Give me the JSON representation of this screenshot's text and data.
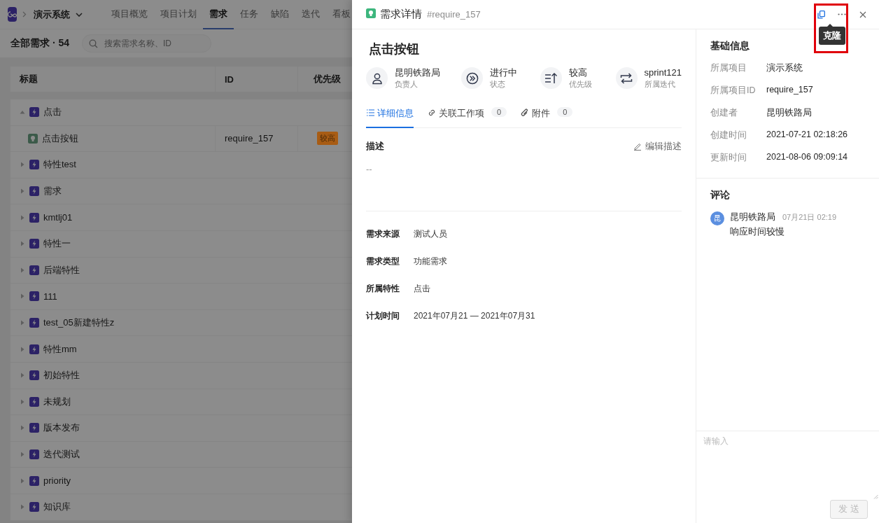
{
  "app": {
    "project": "演示系统",
    "nav_tabs": [
      {
        "label": "项目概览",
        "selected": false
      },
      {
        "label": "项目计划",
        "selected": false
      },
      {
        "label": "需求",
        "selected": true
      },
      {
        "label": "任务",
        "selected": false
      },
      {
        "label": "缺陷",
        "selected": false
      },
      {
        "label": "迭代",
        "selected": false
      },
      {
        "label": "看板",
        "selected": false
      }
    ],
    "list_title": "全部需求 · 54",
    "search": {
      "placeholder": "搜索需求名称、ID"
    },
    "table": {
      "columns": [
        "标题",
        "ID",
        "优先级"
      ],
      "rows": [
        {
          "kind": "feature",
          "title": "点击",
          "expanded": true,
          "children": [
            {
              "kind": "requirement",
              "title": "点击按钮",
              "id": "require_157",
              "priority": "较高"
            }
          ]
        },
        {
          "kind": "feature",
          "title": "特性test",
          "expanded": false
        },
        {
          "kind": "feature",
          "title": "需求",
          "expanded": false
        },
        {
          "kind": "feature",
          "title": "kmtlj01",
          "expanded": false
        },
        {
          "kind": "feature",
          "title": "特性一",
          "expanded": false
        },
        {
          "kind": "feature",
          "title": "后端特性",
          "expanded": false
        },
        {
          "kind": "feature",
          "title": "111",
          "expanded": false
        },
        {
          "kind": "feature",
          "title": "test_05新建特性z",
          "expanded": false
        },
        {
          "kind": "feature",
          "title": "特性mm",
          "expanded": false
        },
        {
          "kind": "feature",
          "title": "初始特性",
          "expanded": false
        },
        {
          "kind": "feature",
          "title": "未规划",
          "expanded": false
        },
        {
          "kind": "feature",
          "title": "版本发布",
          "expanded": false
        },
        {
          "kind": "feature",
          "title": "迭代测试",
          "expanded": false
        },
        {
          "kind": "feature",
          "title": "priority",
          "expanded": false
        },
        {
          "kind": "feature",
          "title": "知识库",
          "expanded": false
        }
      ]
    }
  },
  "drawer": {
    "title": "需求详情",
    "number": "#require_157",
    "tooltip": "克隆",
    "clone_highlighted": true,
    "name": "点击按钮",
    "meta": [
      {
        "kind": "person",
        "value": "昆明铁路局",
        "label": "负责人"
      },
      {
        "kind": "status",
        "value": "进行中",
        "label": "状态"
      },
      {
        "kind": "priority",
        "value": "较高",
        "label": "优先级"
      },
      {
        "kind": "iteration",
        "value": "sprint121",
        "label": "所属迭代"
      }
    ],
    "tabs": [
      {
        "kind": "list",
        "label": "详细信息",
        "selected": true
      },
      {
        "kind": "link",
        "label": "关联工作项",
        "count": "0",
        "selected": false
      },
      {
        "kind": "attachment",
        "label": "附件",
        "count": "0",
        "selected": false
      }
    ],
    "description": {
      "heading": "描述",
      "edit": "编辑描述",
      "text": "--"
    },
    "fields": [
      {
        "label": "需求来源",
        "value": "测试人员"
      },
      {
        "label": "需求类型",
        "value": "功能需求"
      },
      {
        "label": "所属特性",
        "value": "点击"
      },
      {
        "label": "计划时间",
        "value": "2021年07月21 — 2021年07月31"
      }
    ],
    "basic_info": {
      "heading": "基础信息",
      "fields": [
        {
          "label": "所属项目",
          "value": "演示系统"
        },
        {
          "label": "所属项目ID",
          "value": "require_157"
        },
        {
          "label": "创建者",
          "value": "昆明铁路局"
        },
        {
          "label": "创建时间",
          "value": "2021-07-21 02:18:26"
        },
        {
          "label": "更新时间",
          "value": "2021-08-06 09:09:14"
        }
      ]
    },
    "comments": {
      "heading": "评论",
      "items": [
        {
          "avatar": "昆",
          "author": "昆明铁路局",
          "time": "07月21日 02:19",
          "text": "响应时间较慢"
        }
      ]
    },
    "comment_box": {
      "placeholder": "请输入",
      "send": "发 送",
      "send_disabled": true
    }
  }
}
